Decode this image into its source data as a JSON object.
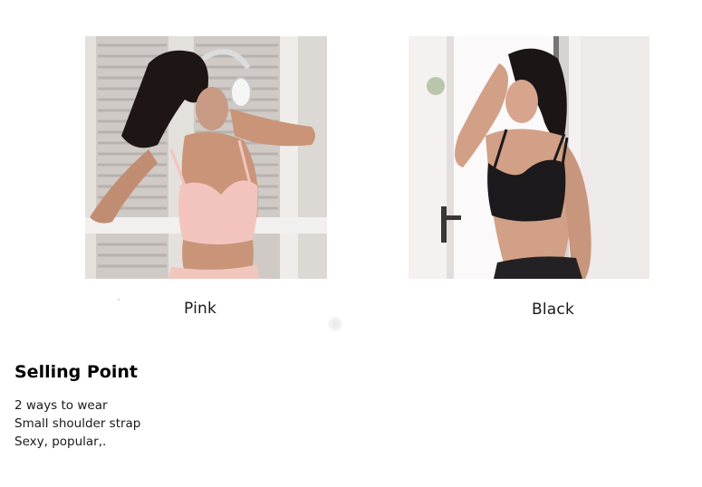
{
  "products": [
    {
      "label": "Pink",
      "accent": "#f2c4bd"
    },
    {
      "label": "Black",
      "accent": "#1c1a1c"
    }
  ],
  "selling_point": {
    "title": "Selling Point",
    "items": [
      "2 ways to wear",
      "Small shoulder strap",
      "Sexy, popular,."
    ]
  }
}
